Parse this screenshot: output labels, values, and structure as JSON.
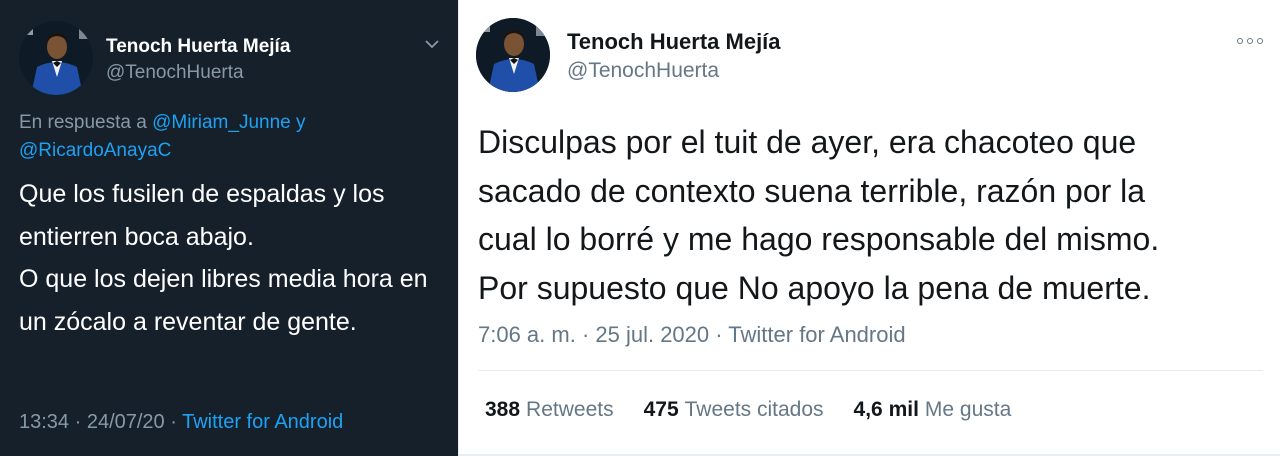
{
  "left_tweet": {
    "author_name": "Tenoch Huerta Mejía",
    "author_handle": "@TenochHuerta",
    "reply_prefix": "En respuesta a ",
    "reply_mention_1": "@Miriam_Junne",
    "reply_joiner": " y",
    "reply_mention_2": "@RicardoAnayaC",
    "text_paragraph_1": "Que los fusilen de espaldas y los entierren boca abajo.",
    "text_paragraph_2": "O que los dejen libres media hora en un zócalo a reventar de gente.",
    "timestamp": "13:34 · 24/07/20 · ",
    "source": "Twitter for Android",
    "icons": {
      "menu": "chevron-down-icon"
    },
    "colors": {
      "background": "#15202b",
      "link": "#1da1f2",
      "secondary": "#8899a6"
    }
  },
  "right_tweet": {
    "author_name": "Tenoch Huerta Mejía",
    "author_handle": "@TenochHuerta",
    "text_lines": [
      "Disculpas por el tuit de ayer, era chacoteo que",
      "sacado de contexto suena terrible, razón por la",
      "cual lo borré y me hago responsable del mismo.",
      "Por supuesto que No apoyo la pena de muerte."
    ],
    "meta": "7:06 a. m. · 25 jul. 2020 · Twitter for Android",
    "stats": {
      "retweets_count": "388",
      "retweets_label": "Retweets",
      "quotes_count": "475",
      "quotes_label": "Tweets citados",
      "likes_count": "4,6 mil",
      "likes_label": "Me gusta"
    },
    "icons": {
      "menu": "more-options-icon"
    },
    "colors": {
      "background": "#ffffff",
      "text": "#14171a",
      "secondary": "#657786"
    }
  }
}
